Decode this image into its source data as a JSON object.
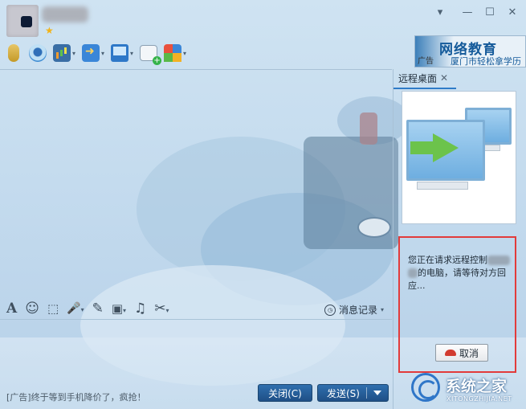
{
  "window": {
    "star_glyph": "★",
    "controls": {
      "menu": "▾",
      "minimize": "—",
      "maximize": "☐",
      "close": "✕"
    }
  },
  "toolbar": {
    "items": [
      "microphone-icon",
      "video-icon",
      "screen-share-icon",
      "file-transfer-icon",
      "remote-desktop-icon",
      "note-add-icon",
      "app-center-icon"
    ],
    "caret": "▾"
  },
  "ad_banner": {
    "tag": "广告",
    "title": "网络教育",
    "subtitle": "厦门市轻松拿学历"
  },
  "edit_toolbar": {
    "font": "A",
    "emoji": "☺",
    "screenshot": "⬚",
    "voice": "🎤",
    "edit": "✎",
    "image": "▣",
    "music": "♫",
    "scissors": "✂",
    "history_label": "消息记录",
    "caret": "▾"
  },
  "footer": {
    "ad_text": "[广告]终于等到手机降价了，疯抢！",
    "close_label": "关闭(C)",
    "send_label": "发送(S)"
  },
  "side_panel": {
    "tab_label": "远程桌面",
    "tab_close": "✕",
    "request": {
      "text_part1": "您正在请求远程控制",
      "text_part2": "的电脑，请等待对方回应...",
      "cancel_label": "取消"
    }
  },
  "watermark": {
    "title": "系统之家",
    "subtitle": "XITONGZHIJIA.NET"
  },
  "colors": {
    "accent": "#2f7bc8",
    "highlight_border": "#e23b3b",
    "send_button": "#2a629e"
  }
}
